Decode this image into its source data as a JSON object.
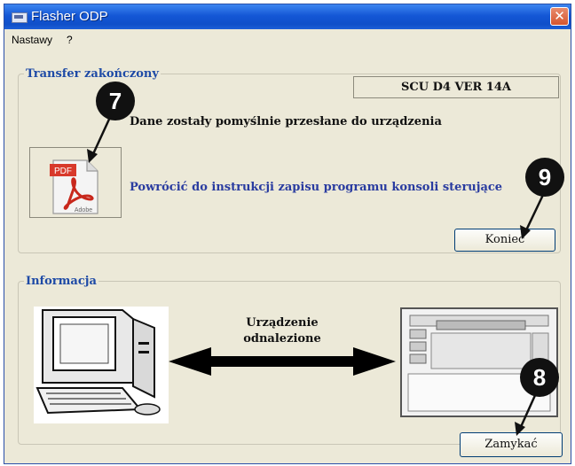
{
  "window": {
    "title": "Flasher ODP",
    "close_glyph": "✕"
  },
  "menu": {
    "items": [
      "Nastawy",
      "?"
    ]
  },
  "transfer": {
    "legend": "Transfer zakończony",
    "version": "SCU D4 VER  14A",
    "message": "Dane zostały pomyślnie przesłane do urządzenia",
    "pdf_label": "PDF",
    "pdf_brand": "Adobe",
    "link_text": "Powrócić do instrukcji zapisu programu konsoli sterujące",
    "end_button": "Koniec"
  },
  "info": {
    "legend": "Informacja",
    "device_status_line1": "Urządzenie",
    "device_status_line2": "odnalezione",
    "close_button": "Zamykać"
  },
  "callouts": {
    "seven": "7",
    "eight": "8",
    "nine": "9"
  },
  "colors": {
    "titlebar": "#1457d6",
    "legend": "#1e4aa6",
    "link": "#2a3ca0",
    "callout": "#111111"
  }
}
